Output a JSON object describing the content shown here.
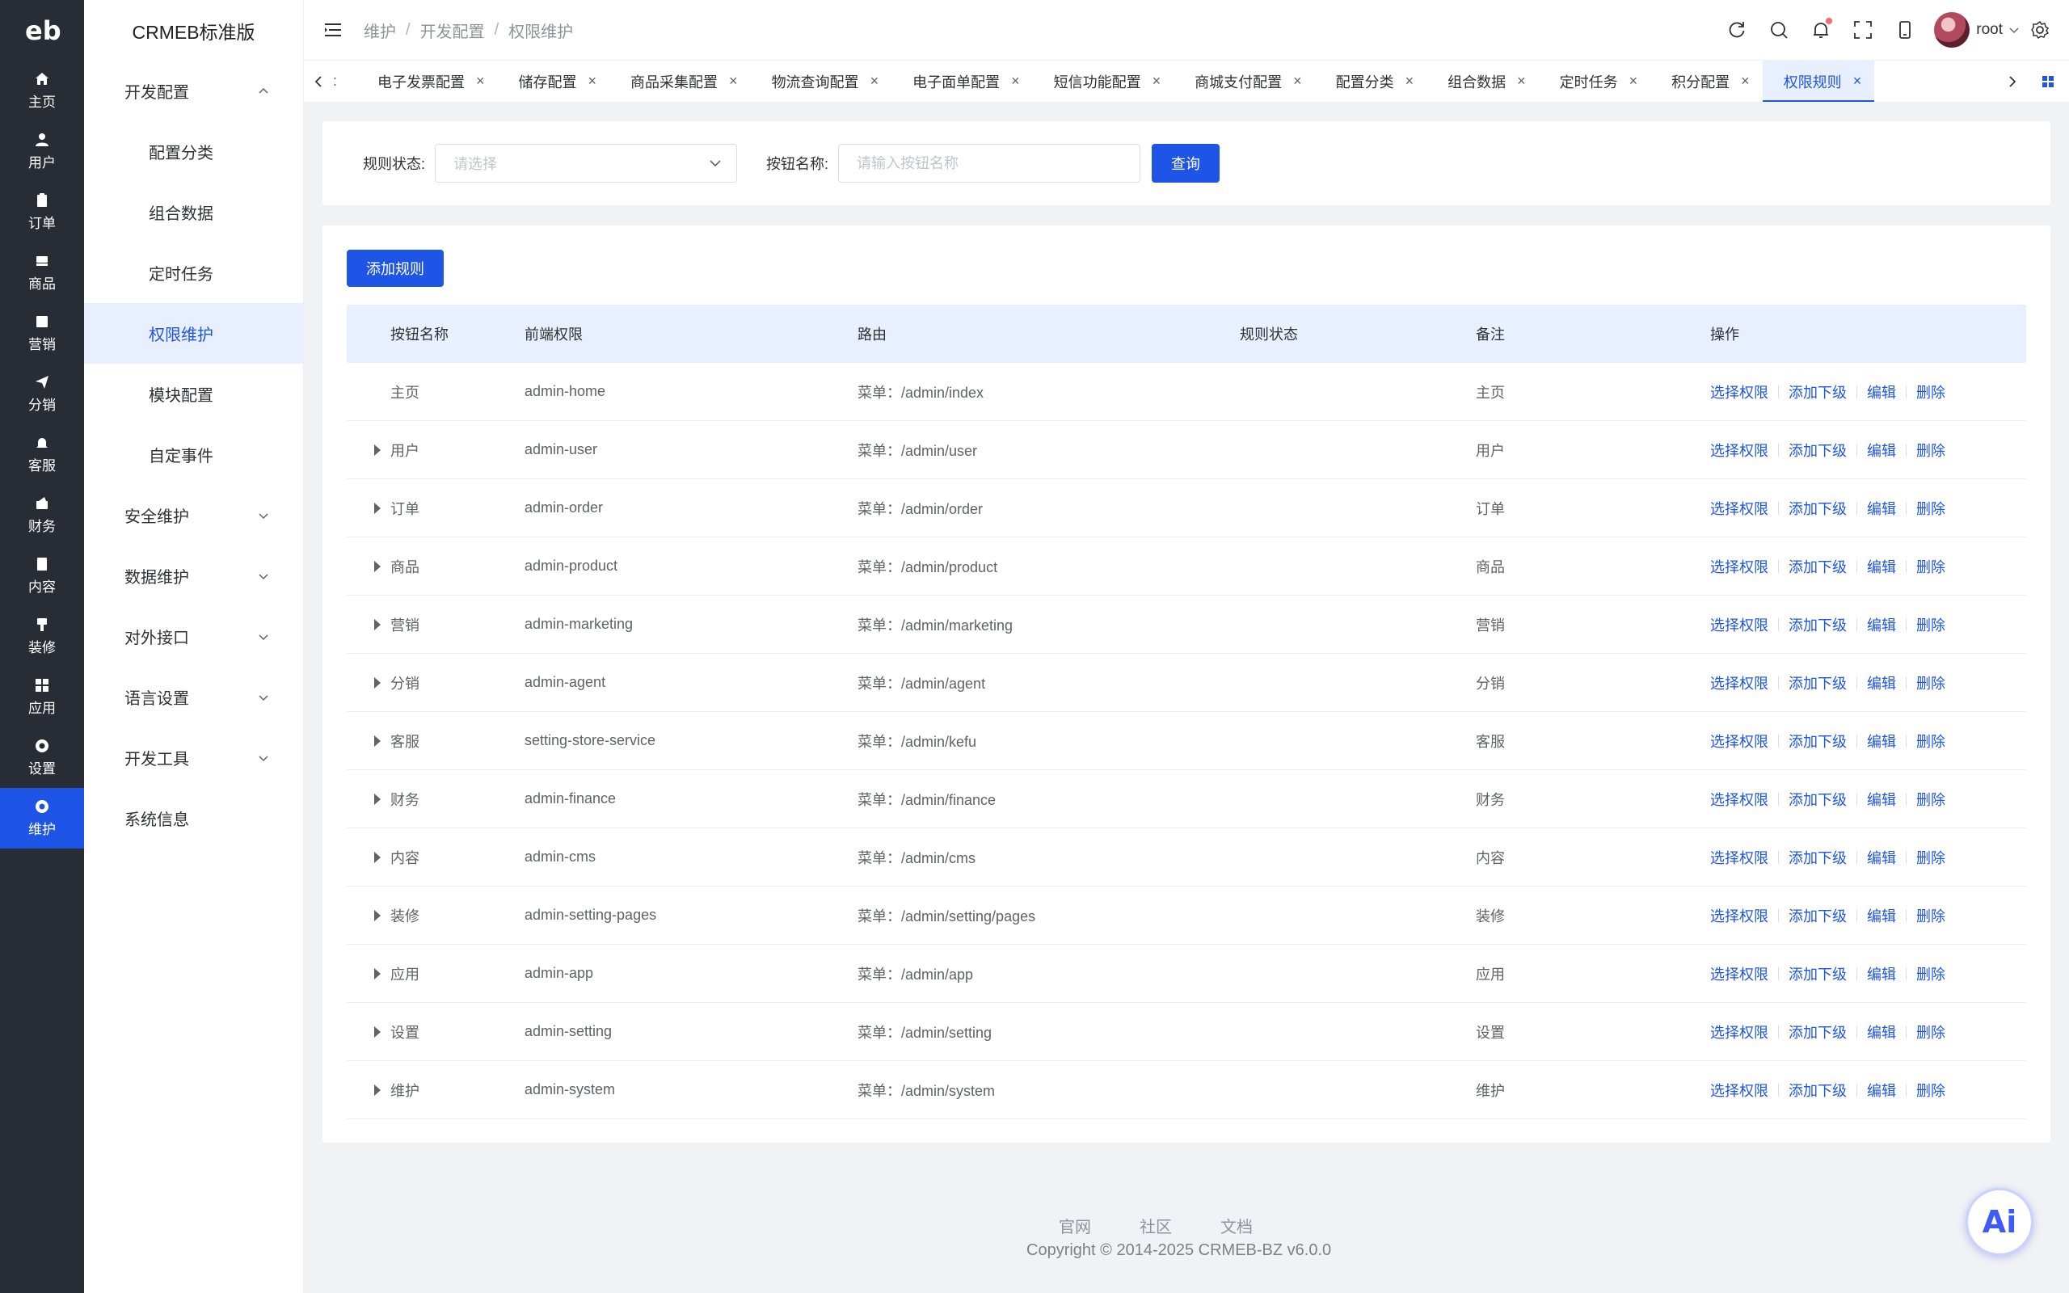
{
  "rail": {
    "logo": "eb",
    "items": [
      {
        "label": "主页",
        "icon": "home-icon"
      },
      {
        "label": "用户",
        "icon": "user-icon"
      },
      {
        "label": "订单",
        "icon": "order-icon"
      },
      {
        "label": "商品",
        "icon": "product-icon"
      },
      {
        "label": "营销",
        "icon": "marketing-icon"
      },
      {
        "label": "分销",
        "icon": "send-icon"
      },
      {
        "label": "客服",
        "icon": "bell-icon"
      },
      {
        "label": "财务",
        "icon": "finance-icon"
      },
      {
        "label": "内容",
        "icon": "content-icon"
      },
      {
        "label": "装修",
        "icon": "decor-icon"
      },
      {
        "label": "应用",
        "icon": "apps-icon"
      },
      {
        "label": "设置",
        "icon": "settings-icon"
      },
      {
        "label": "维护",
        "icon": "maintain-icon"
      }
    ]
  },
  "sidebar": {
    "title": "CRMEB标准版",
    "dev_config": "开发配置",
    "sub_items": [
      "配置分类",
      "组合数据",
      "定时任务",
      "权限维护",
      "模块配置",
      "自定事件"
    ],
    "groups": [
      "安全维护",
      "数据维护",
      "对外接口",
      "语言设置",
      "开发工具"
    ],
    "system_info": "系统信息"
  },
  "header": {
    "breadcrumb": [
      "维护",
      "开发配置",
      "权限维护"
    ],
    "user": "root"
  },
  "tabs": {
    "ellipsis": ":",
    "items": [
      "电子发票配置",
      "储存配置",
      "商品采集配置",
      "物流查询配置",
      "电子面单配置",
      "短信功能配置",
      "商城支付配置",
      "配置分类",
      "组合数据",
      "定时任务",
      "积分配置",
      "权限规则"
    ],
    "active_index": 11
  },
  "filter": {
    "status_label": "规则状态:",
    "status_placeholder": "请选择",
    "name_label": "按钮名称:",
    "name_placeholder": "请输入按钮名称",
    "query_button": "查询"
  },
  "table": {
    "add_button": "添加规则",
    "columns": [
      "按钮名称",
      "前端权限",
      "路由",
      "规则状态",
      "备注",
      "操作"
    ],
    "ops": [
      "选择权限",
      "添加下级",
      "编辑",
      "删除"
    ],
    "rows": [
      {
        "name": "主页",
        "front": "admin-home",
        "route": "菜单：/admin/index",
        "enabled": true,
        "note": "主页",
        "expandable": false
      },
      {
        "name": "用户",
        "front": "admin-user",
        "route": "菜单：/admin/user",
        "enabled": true,
        "note": "用户",
        "expandable": true
      },
      {
        "name": "订单",
        "front": "admin-order",
        "route": "菜单：/admin/order",
        "enabled": true,
        "note": "订单",
        "expandable": true
      },
      {
        "name": "商品",
        "front": "admin-product",
        "route": "菜单：/admin/product",
        "enabled": true,
        "note": "商品",
        "expandable": true
      },
      {
        "name": "营销",
        "front": "admin-marketing",
        "route": "菜单：/admin/marketing",
        "enabled": true,
        "note": "营销",
        "expandable": true
      },
      {
        "name": "分销",
        "front": "admin-agent",
        "route": "菜单：/admin/agent",
        "enabled": true,
        "note": "分销",
        "expandable": true
      },
      {
        "name": "客服",
        "front": "setting-store-service",
        "route": "菜单：/admin/kefu",
        "enabled": true,
        "note": "客服",
        "expandable": true
      },
      {
        "name": "财务",
        "front": "admin-finance",
        "route": "菜单：/admin/finance",
        "enabled": true,
        "note": "财务",
        "expandable": true
      },
      {
        "name": "内容",
        "front": "admin-cms",
        "route": "菜单：/admin/cms",
        "enabled": true,
        "note": "内容",
        "expandable": true
      },
      {
        "name": "装修",
        "front": "admin-setting-pages",
        "route": "菜单：/admin/setting/pages",
        "enabled": true,
        "note": "装修",
        "expandable": true
      },
      {
        "name": "应用",
        "front": "admin-app",
        "route": "菜单：/admin/app",
        "enabled": true,
        "note": "应用",
        "expandable": true
      },
      {
        "name": "设置",
        "front": "admin-setting",
        "route": "菜单：/admin/setting",
        "enabled": true,
        "note": "设置",
        "expandable": true
      },
      {
        "name": "维护",
        "front": "admin-system",
        "route": "菜单：/admin/system",
        "enabled": true,
        "note": "维护",
        "expandable": true
      }
    ]
  },
  "footer": {
    "links": [
      "官网",
      "社区",
      "文档"
    ],
    "copyright": "Copyright © 2014-2025 CRMEB-BZ v6.0.0"
  },
  "ai_fab": "Ai",
  "colors": {
    "primary": "#1f55e6",
    "rail_bg": "#282c34",
    "active_bg": "#e8efff"
  }
}
